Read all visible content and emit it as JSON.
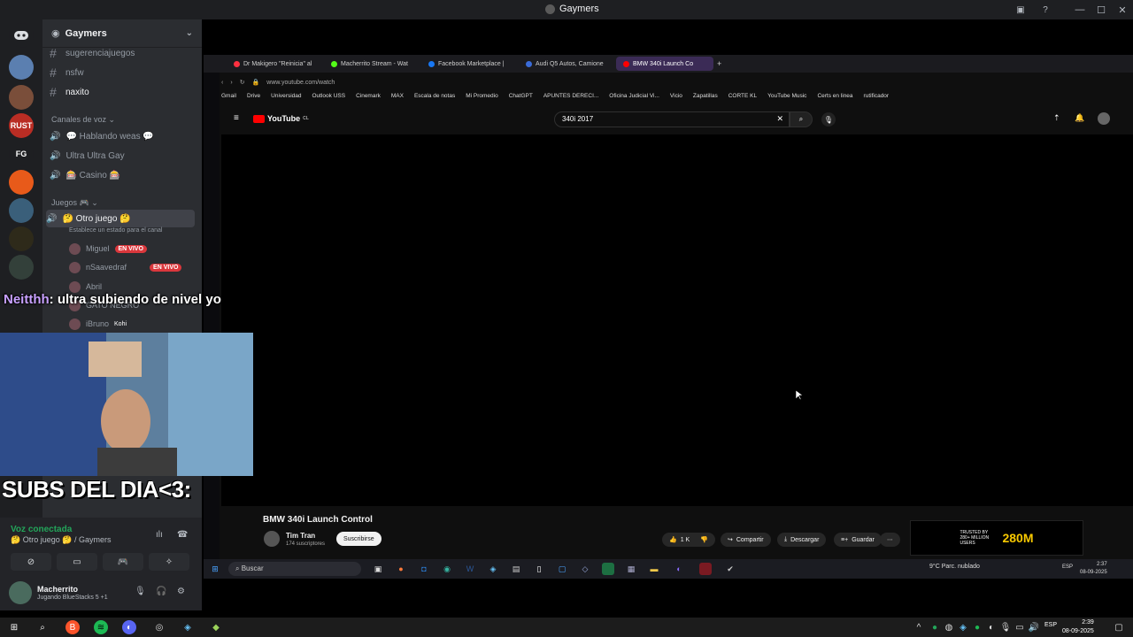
{
  "window": {
    "title": "Gaymers"
  },
  "guild": {
    "name": "Gaymers"
  },
  "rail": {
    "servers": [
      "FG",
      "RUST"
    ]
  },
  "channels": {
    "text": [
      "sugerenciajuegos",
      "nsfw",
      "naxito"
    ],
    "voice_category": "Canales de voz",
    "voice": [
      "💬 Hablando weas 💬",
      "Ultra Ultra Gay",
      "🎰 Casino 🎰"
    ],
    "games_category": "Juegos 🎮",
    "active_voice": "🤔 Otro juego 🤔",
    "active_voice_status": "Establece un estado para el canal",
    "members": [
      {
        "name": "Miguel",
        "badge": "EN VIVO"
      },
      {
        "name": "nSaavedraf",
        "badge": "EN VIVO"
      },
      {
        "name": "Abril",
        "badge": ""
      },
      {
        "name": "GATO NEGRO",
        "badge": ""
      },
      {
        "name": "iBruno",
        "badge": "Kohi"
      }
    ]
  },
  "overlay": {
    "chat_user": "Neitthh",
    "chat_message": ": ultra subiendo de nivel yo",
    "subs_text": "SUBS DEL DIA<3:"
  },
  "voice_panel": {
    "status": "Voz conectada",
    "channel": "🤔 Otro juego 🤔 / Gaymers",
    "user_name": "Macherrito",
    "user_activity": "Jugando BlueStacks 5 +1"
  },
  "browser": {
    "tabs": [
      {
        "label": "Dr Makigero \"Reinicia\" al",
        "color": "#ff3040"
      },
      {
        "label": "Macherrito Stream - Wat",
        "color": "#53fc18"
      },
      {
        "label": "Facebook Marketplace |",
        "color": "#1877f2"
      },
      {
        "label": "Audi Q5 Autos, Camione",
        "color": "#3a6bd8"
      },
      {
        "label": "BMW 340i Launch Co",
        "color": "#ff0000"
      }
    ],
    "url": "www.youtube.com/watch",
    "bookmarks": [
      "Gmail",
      "Drive",
      "Universidad",
      "Outlook USS",
      "Cinemark",
      "MAX",
      "Escala de notas",
      "Mi Promedio",
      "ChatGPT",
      "APUNTES DERECI...",
      "Oficina Judicial Vi...",
      "Vicio",
      "Zapatillas",
      "CORTE KL",
      "YouTube Music",
      "Certs en linea",
      "rutificador"
    ]
  },
  "youtube": {
    "logo": "YouTube",
    "logo_region": "CL",
    "search_value": "340i 2017",
    "video_title": "BMW 340i Launch Control",
    "channel_name": "Tim Tran",
    "channel_subs": "174 suscriptores",
    "subscribe_label": "Suscribirse",
    "likes": "1 K",
    "share_label": "Compartir",
    "download_label": "Descargar",
    "save_label": "Guardar",
    "ad_big": "280M",
    "ad_small": "TRUSTED BY 280+ MILLION USERS"
  },
  "inner_taskbar": {
    "search_placeholder": "Buscar",
    "weather": "9°C  Parc. nublado",
    "lang": "ESP",
    "time": "2:37",
    "date": "08-09-2025"
  },
  "taskbar": {
    "lang": "ESP",
    "time": "2:39",
    "date": "08-09-2025"
  },
  "colors": {
    "discord_bg": "#2b2d31",
    "rail_bg": "#1e1f22",
    "live_red": "#da373c",
    "voice_green": "#23a55a"
  }
}
